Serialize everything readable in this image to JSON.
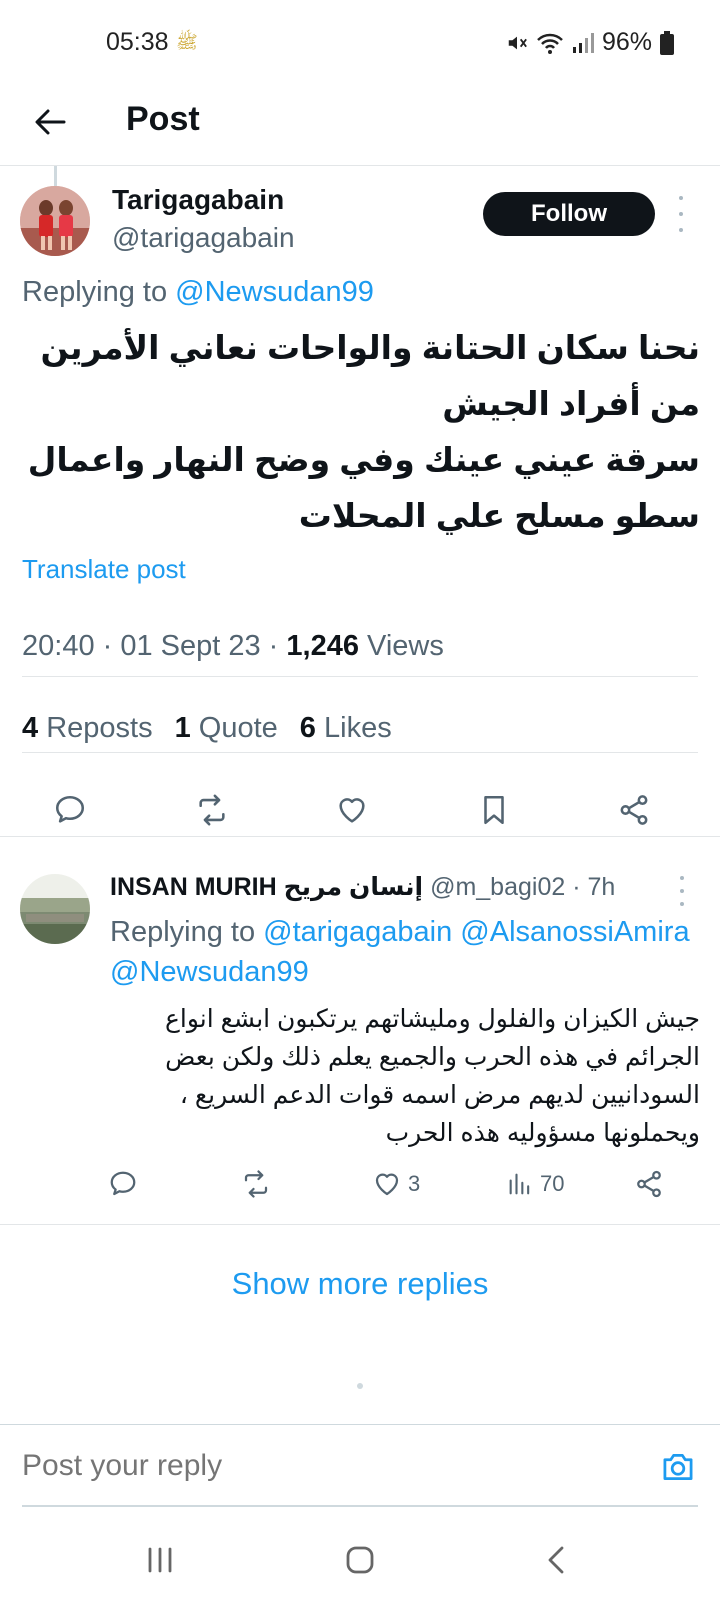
{
  "status_bar": {
    "time": "05:38",
    "extra_glyph": "ﷺ",
    "battery": "96%"
  },
  "header": {
    "title": "Post"
  },
  "post": {
    "author_name": "Tarigagabain",
    "author_handle": "@tarigagabain",
    "follow_label": "Follow",
    "replying_prefix": "Replying to ",
    "replying_mention": "@Newsudan99",
    "text_line1": "نحنا سكان الحتانة والواحات نعاني الأمرين من أفراد الجيش",
    "text_line2": "سرقة عيني عينك وفي وضح النهار واعمال سطو مسلح علي المحلات",
    "translate_label": "Translate post",
    "timestamp": "20:40 · 01 Sept 23 · ",
    "views_count": "1,246",
    "views_label": " Views",
    "reposts_count": "4",
    "reposts_label": " Reposts",
    "quotes_count": "1",
    "quotes_label": " Quote",
    "likes_count": "6",
    "likes_label": " Likes"
  },
  "reply": {
    "author_name": "INSAN MURIH إنسان مريح",
    "author_handle": " @m_bagi02 · 7h",
    "replying_prefix": "Replying to ",
    "replying_mention1": "@tarigagabain",
    "replying_mention2": " @AlsanossiAmira",
    "replying_mention3": "@Newsudan99",
    "text_line1": "جيش الكيزان والفلول ومليشاتهم يرتكبون ابشع انواع",
    "text_line2": "الجرائم في هذه الحرب والجميع يعلم ذلك ولكن بعض",
    "text_line3": "السودانيين لديهم مرض اسمه قوات الدعم السريع ،",
    "text_line4": "ويحملونها مسؤوليه هذه الحرب",
    "likes_count": "3",
    "views_count": "70"
  },
  "show_more_label": "Show more replies",
  "compose": {
    "placeholder": "Post your reply"
  },
  "colors": {
    "accent": "#1d9bf0",
    "text": "#0f1419",
    "secondary": "#536471"
  }
}
